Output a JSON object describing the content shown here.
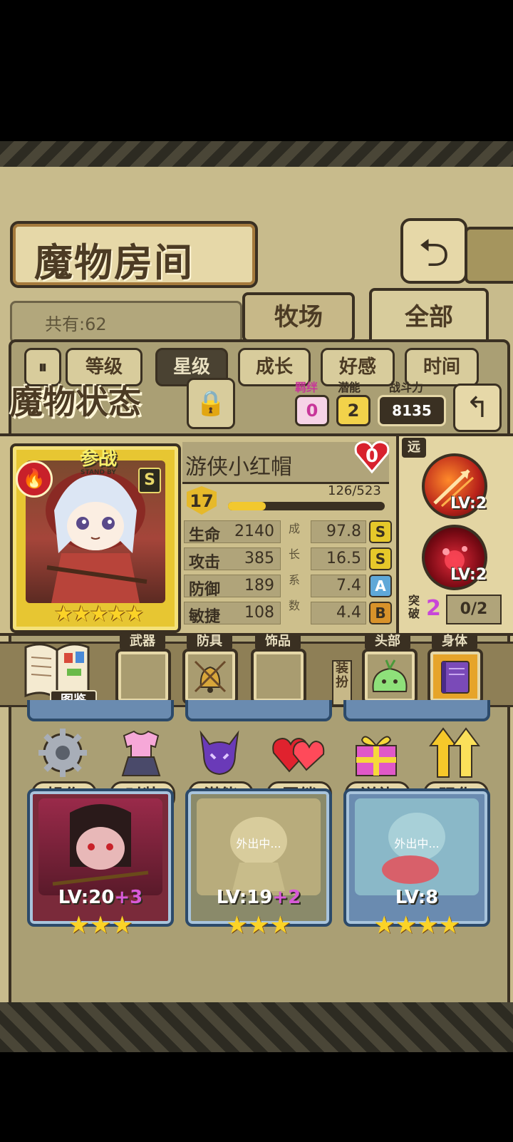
{
  "title": "魔物房间",
  "header": {
    "total_label": "共有:62",
    "tabs": [
      "牧场",
      "全部"
    ]
  },
  "sort": {
    "buttons": [
      "等级",
      "星级",
      "成长",
      "好感",
      "时间"
    ],
    "active": "星级"
  },
  "status": {
    "title": "魔物状态",
    "bond_label": "羁绊",
    "bond_value": "0",
    "potential_label": "潜能",
    "potential_value": "2",
    "power_label": "战斗力",
    "power_value": "8135"
  },
  "monster": {
    "standby_cn": "参战",
    "standby_en": "STAND BY",
    "rank": "S",
    "stars": "★★★★★",
    "name": "游侠小红帽",
    "affection": "0",
    "level": "17",
    "exp_text": "126/523",
    "exp_progress": 0.24,
    "growth_vertical": "成长系数",
    "stats": [
      {
        "label": "生命",
        "value": "2140",
        "growth": "97.8",
        "grade": "S"
      },
      {
        "label": "攻击",
        "value": "385",
        "growth": "16.5",
        "grade": "S"
      },
      {
        "label": "防御",
        "value": "189",
        "growth": "7.4",
        "grade": "A"
      },
      {
        "label": "敏捷",
        "value": "108",
        "growth": "4.4",
        "grade": "B"
      }
    ]
  },
  "skills": {
    "range": "远",
    "items": [
      {
        "lv": "LV:2"
      },
      {
        "lv": "LV:2"
      }
    ],
    "break_label": "突破",
    "break_value": "2",
    "break_progress": "0/2"
  },
  "equipment": {
    "book_label": "图鉴",
    "slots": [
      "武器",
      "防具",
      "饰品"
    ],
    "dress_label": "装扮",
    "dress_slots": [
      "头部",
      "身体"
    ]
  },
  "actions": [
    "操作",
    "时装",
    "潜能",
    "羁绊",
    "送礼",
    "强化"
  ],
  "roster": [
    {
      "lv": "LV:20",
      "plus": "+3",
      "stars": "★★★",
      "status": ""
    },
    {
      "lv": "LV:19",
      "plus": "+2",
      "stars": "★★★",
      "status": "外出中..."
    },
    {
      "lv": "LV:8",
      "plus": "",
      "stars": "★★★★",
      "status": "外出中..."
    }
  ],
  "colors": {
    "panel": "#cdbf8c",
    "dark": "#3a3022",
    "gold": "#e7c632",
    "accent_pink": "#c846d8"
  }
}
